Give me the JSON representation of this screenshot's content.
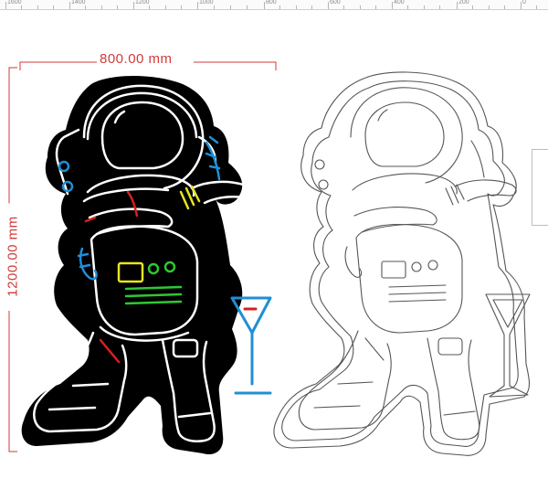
{
  "ruler": {
    "labels": [
      "1600",
      "1400",
      "1200",
      "1000",
      "800",
      "600",
      "400",
      "200",
      "0"
    ]
  },
  "dimensions": {
    "width_label": "800.00 mm",
    "height_label": "1200.00 mm"
  },
  "colors": {
    "dimension": "#d23a3a",
    "neon_white": "#ffffff",
    "neon_blue": "#1f8fd6",
    "neon_red": "#d81f1f",
    "neon_yellow": "#e8e41a",
    "neon_green": "#2ec832",
    "backboard": "#000000",
    "outline": "#555555"
  },
  "icons": {
    "left_artwork": "neon-astronaut-icon",
    "right_artwork": "astronaut-outline-icon",
    "glass": "martini-glass-icon"
  }
}
